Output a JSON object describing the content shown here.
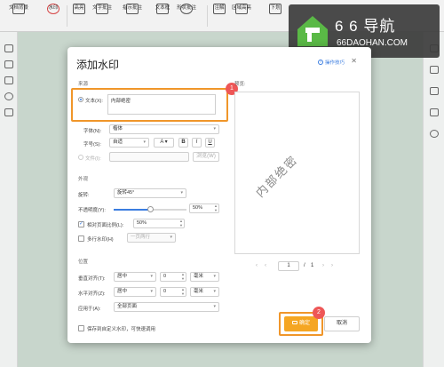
{
  "toolbar": {
    "items": [
      {
        "label": "文档背景",
        "icon": "document-background-icon"
      },
      {
        "label": "水印",
        "icon": "watermark-icon"
      },
      {
        "label": "高亮",
        "icon": "highlight-icon"
      },
      {
        "label": "文字批注",
        "icon": "text-note-icon"
      },
      {
        "label": "指示批注",
        "icon": "arrow-note-icon"
      },
      {
        "label": "文本框",
        "icon": "textbox-icon"
      },
      {
        "label": "形状批注",
        "icon": "shape-note-icon"
      },
      {
        "label": "注解",
        "icon": "annotation-icon"
      },
      {
        "label": "区域高亮",
        "icon": "area-highlight-icon"
      },
      {
        "label": "下划",
        "icon": "underline-icon"
      }
    ]
  },
  "logo": {
    "title": "6 6 导航",
    "subtitle": "66DAOHAN.COM"
  },
  "dialog": {
    "title": "添加水印",
    "help": "操作技巧",
    "source_section": "来源",
    "text_radio": "文本(X):",
    "text_value": "内部绝密",
    "font_label": "字体(N):",
    "font_value": "楷体",
    "size_label": "字号(S):",
    "size_value": "自适",
    "bold": "B",
    "italic": "I",
    "underline": "U",
    "file_radio": "文件(I):",
    "browse": "浏览(W)",
    "appearance_section": "外观",
    "rotation_label": "旋转:",
    "rotation_value": "旋转45°",
    "opacity_label": "不透明度(Y):",
    "opacity_value": "50%",
    "opacity_fraction": 0.5,
    "relative_scale_label": "相对页面比例(L):",
    "relative_scale_value": "50%",
    "multiline_label": "多行水印(H)",
    "multiline_value": "一页两行",
    "position_section": "位置",
    "vertical_label": "垂直对齐(T):",
    "vertical_value": "居中",
    "vertical_offset": "0",
    "vertical_unit": "毫米",
    "horizontal_label": "水平对齐(Z):",
    "horizontal_value": "居中",
    "horizontal_offset": "0",
    "horizontal_unit": "毫米",
    "apply_label": "应用于(A):",
    "apply_value": "全部页面",
    "save_label": "保存到自定义水印，可快速调用",
    "preview_label": "预览:",
    "preview_watermark": "内部绝密",
    "page_current": "1",
    "page_sep": "/",
    "page_total": "1",
    "ok": "确定",
    "cancel": "取消",
    "badge1": "1",
    "badge2": "2"
  }
}
